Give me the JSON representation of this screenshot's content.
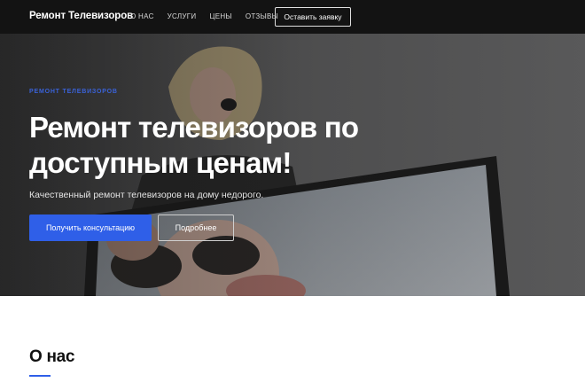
{
  "header": {
    "logo": "Ремонт Телевизоров",
    "nav": [
      {
        "label": "О НАС"
      },
      {
        "label": "УСЛУГИ"
      },
      {
        "label": "ЦЕНЫ"
      },
      {
        "label": "ОТЗЫВЫ"
      }
    ],
    "cta_label": "Оставить заявку"
  },
  "hero": {
    "kicker": "Ремонт телевизоров",
    "title": "Ремонт телевизоров по доступным ценам!",
    "subtitle": "Качественный ремонт телевизоров на дому недорого.",
    "primary_button": "Получить консультацию",
    "secondary_button": "Подробнее"
  },
  "about": {
    "title": "О нас"
  },
  "colors": {
    "accent": "#2f5fe8",
    "header_bg": "#131313"
  }
}
